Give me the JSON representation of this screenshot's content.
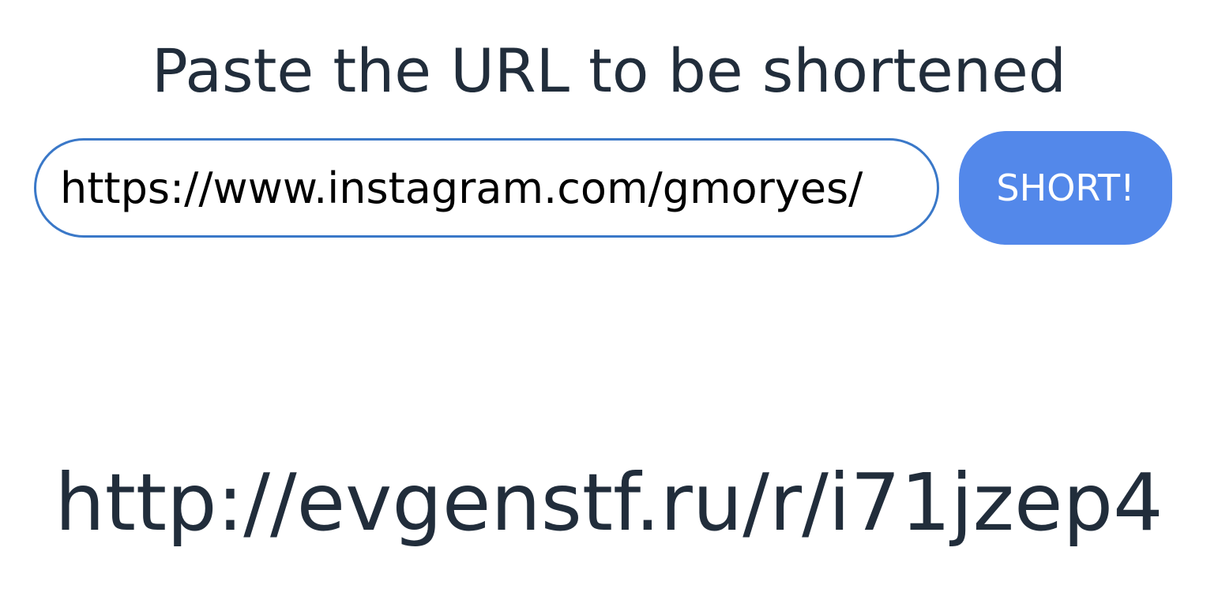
{
  "heading": "Paste the URL to be shortened",
  "url_input": {
    "value": "https://www.instagram.com/gmoryes/"
  },
  "short_button": {
    "label": "SHORT!"
  },
  "result": {
    "short_url": "http://evgenstf.ru/r/i71jzep4"
  },
  "colors": {
    "text": "#212d3b",
    "input_border": "#3a78c8",
    "button_bg": "#5388ea",
    "button_text": "#ffffff"
  }
}
